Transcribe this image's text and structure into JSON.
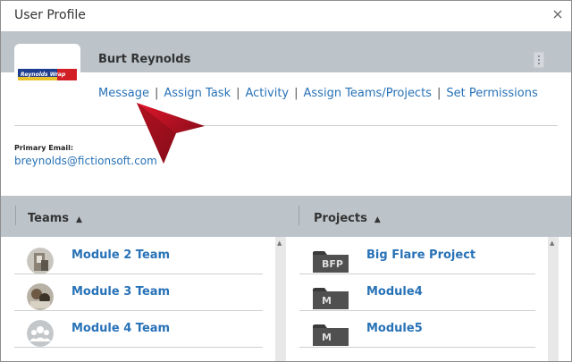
{
  "dialog": {
    "title": "User Profile"
  },
  "profile": {
    "name": "Burt Reynolds",
    "logo_text": "Reynolds Wrap"
  },
  "actions": {
    "message": "Message",
    "assign_task": "Assign Task",
    "activity": "Activity",
    "assign_teams": "Assign Teams/Projects",
    "set_permissions": "Set Permissions",
    "separator": "|"
  },
  "email": {
    "label": "Primary Email:",
    "value": "breynolds@fictionsoft.com"
  },
  "teams": {
    "header": "Teams",
    "sort_icon": "▲",
    "items": [
      {
        "label": "Module 2 Team"
      },
      {
        "label": "Module 3 Team"
      },
      {
        "label": "Module 4 Team"
      }
    ]
  },
  "projects": {
    "header": "Projects",
    "sort_icon": "▲",
    "items": [
      {
        "label": "Big Flare Project",
        "tag": "BFP"
      },
      {
        "label": "Module4",
        "tag": "M"
      },
      {
        "label": "Module5",
        "tag": "M"
      }
    ]
  },
  "colors": {
    "accent": "#2872b7",
    "header_bar": "#bcc3c9",
    "pointer_arrow": "#c8102e"
  },
  "icons": {
    "close": "close-icon",
    "more": "kebab-menu-icon",
    "pointer": "red-arrow-pointer-icon"
  }
}
